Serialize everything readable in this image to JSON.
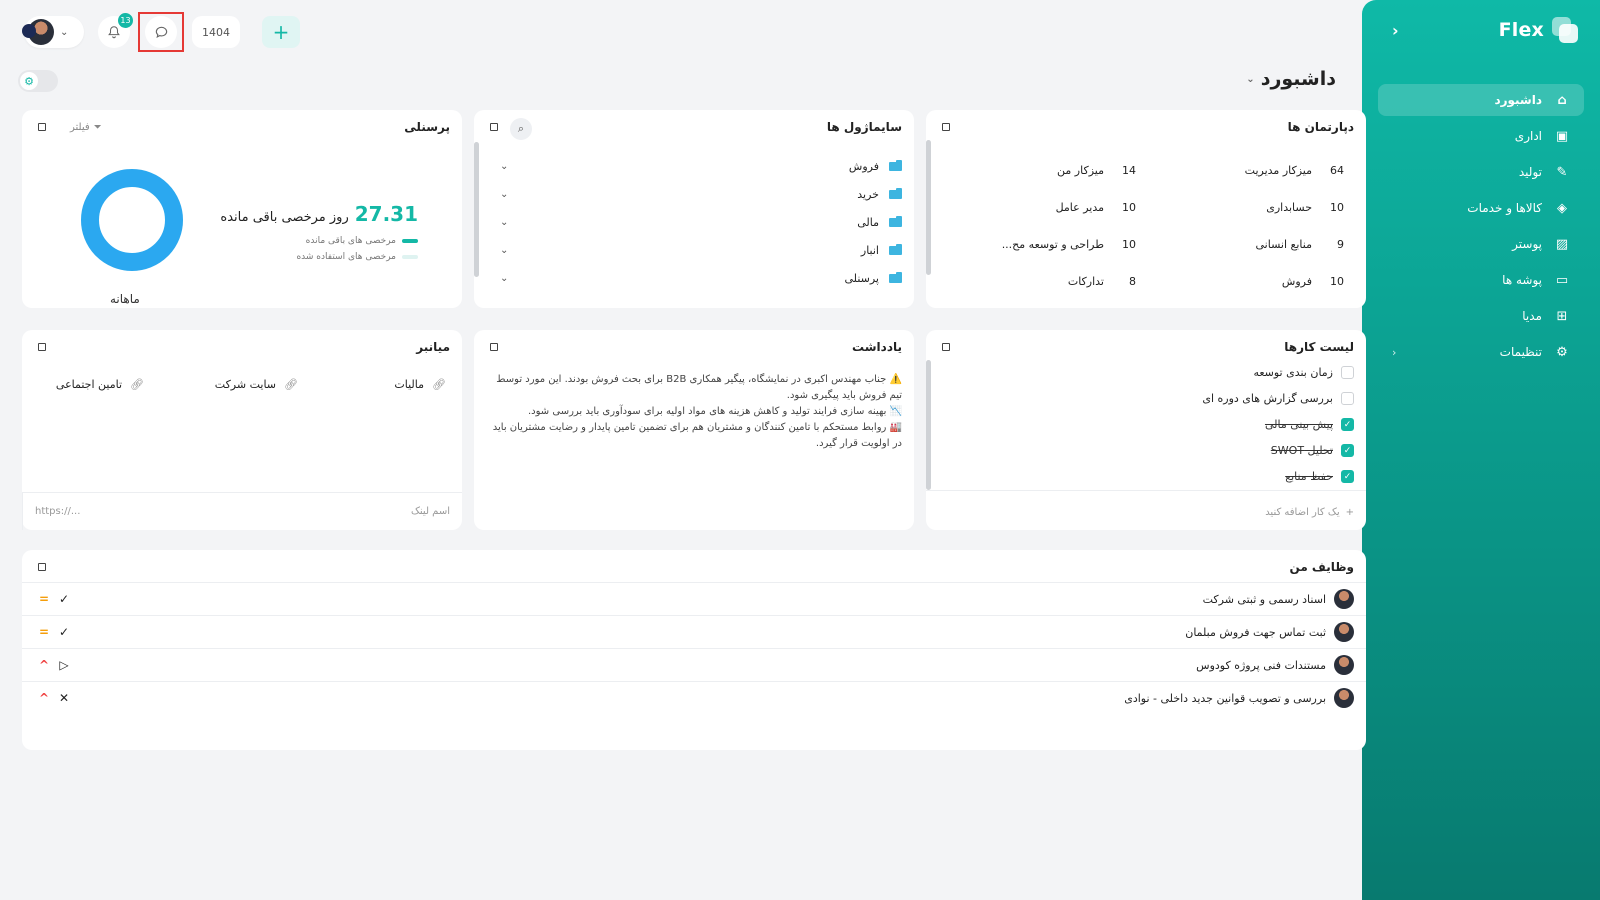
{
  "sidebar": {
    "brand": "Flex",
    "collapse_icon": "chevron-left-icon",
    "items": [
      {
        "label": "داشبورد",
        "icon": "⌂"
      },
      {
        "label": "اداری",
        "icon": "▣"
      },
      {
        "label": "تولید",
        "icon": "✎"
      },
      {
        "label": "کالاها و خدمات",
        "icon": "◈"
      },
      {
        "label": "پوستر",
        "icon": "▨"
      },
      {
        "label": "پوشه ها",
        "icon": "▭"
      },
      {
        "label": "مدیا",
        "icon": "⊞"
      },
      {
        "label": "تنظیمات",
        "icon": "⚙"
      }
    ]
  },
  "topbar": {
    "notifications_count": "13",
    "year": "1404",
    "plus": "+"
  },
  "page": {
    "title": "داشبورد"
  },
  "departments": {
    "title": "دپارتمان ها",
    "items": [
      {
        "name": "میزکار مدیریت",
        "count": "64"
      },
      {
        "name": "میزکار من",
        "count": "14"
      },
      {
        "name": "حسابداری",
        "count": "10"
      },
      {
        "name": "مدیر عامل",
        "count": "10"
      },
      {
        "name": "منابع انسانی",
        "count": "9"
      },
      {
        "name": "طراحی و توسعه مح...",
        "count": "10"
      },
      {
        "name": "فروش",
        "count": "10"
      },
      {
        "name": "تدارکات",
        "count": "8"
      }
    ]
  },
  "modules": {
    "title": "سایماژول ها",
    "items": [
      "فروش",
      "خرید",
      "مالی",
      "انبار",
      "پرسنلی"
    ]
  },
  "personnel": {
    "title": "پرسنلی",
    "filter_label": "فیلتر",
    "remaining_value": "27.31",
    "remaining_unit": "روز مرخصی باقی مانده",
    "legend_remaining": "مرخصی های باقی مانده",
    "legend_used": "مرخصی های استفاده شده",
    "period": "ماهانه",
    "remaining_fraction": 1.0,
    "color_remaining": "#2ba8f0",
    "color_used": "#dff3f1"
  },
  "tasks": {
    "title": "لیست کارها",
    "items": [
      {
        "label": "زمان بندی توسعه",
        "done": false
      },
      {
        "label": "بررسی گزارش های دوره ای",
        "done": false
      },
      {
        "label": "پیش بینی مالی",
        "done": true
      },
      {
        "label": "تحلیل SWOT",
        "done": true
      },
      {
        "label": "حفظ منابع",
        "done": true
      }
    ],
    "add_placeholder": "یک کار اضافه کنید"
  },
  "notes": {
    "title": "یادداشت",
    "lines": [
      "⚠️ جناب مهندس اکبری در نمایشگاه، پیگیر همکاری B2B برای بحث فروش بودند. این مورد توسط تیم فروش باید پیگیری شود.",
      "📉 بهینه سازی فرایند تولید و کاهش هزینه های مواد اولیه برای سودآوری باید بررسی شود.",
      "🏭 روابط مستحکم با تامین کنندگان و مشتریان هم برای تضمین  تامین پایدار و رضایت مشتریان باید در اولویت قرار گیرد."
    ]
  },
  "shortcuts": {
    "title": "میانبر",
    "links": [
      "مالیات",
      "سایت شرکت",
      "تامین اجتماعی"
    ],
    "name_placeholder": "اسم لینک",
    "url_placeholder": "https://..."
  },
  "my_jobs": {
    "title": "وظایف من",
    "items": [
      {
        "title": "اسناد رسمی و ثبتی شرکت",
        "status": "✓",
        "priority": "=",
        "priority_color": "#f59e0b"
      },
      {
        "title": "ثبت تماس جهت فروش مبلمان",
        "status": "✓",
        "priority": "=",
        "priority_color": "#f59e0b"
      },
      {
        "title": "مستندات فنی پروژه کودوس",
        "status": "▷",
        "priority": "^",
        "priority_color": "#ef4444"
      },
      {
        "title": "بررسی و تصویب قوانین جدید داخلی - نوادی",
        "status": "✕",
        "priority": "^",
        "priority_color": "#ef4444"
      }
    ]
  }
}
